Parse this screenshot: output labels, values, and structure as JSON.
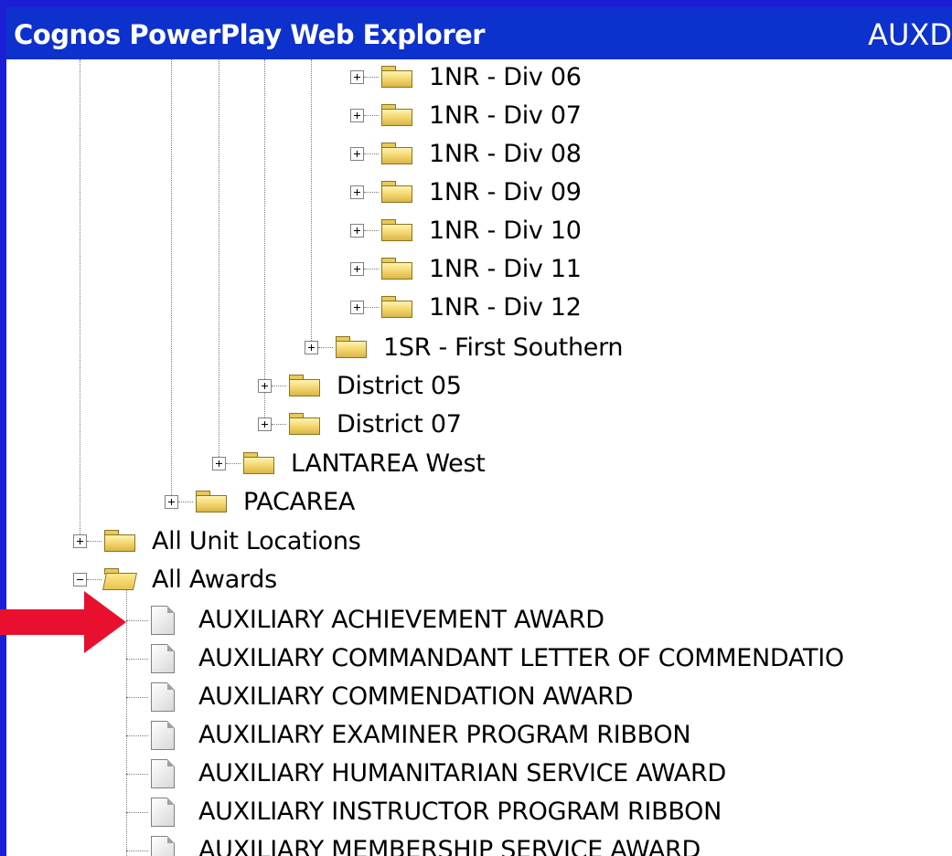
{
  "window": {
    "title": "Cognos PowerPlay Web Explorer",
    "title_right": "AUXD"
  },
  "tree": {
    "divisions": [
      {
        "label": "1NR - Div 06"
      },
      {
        "label": "1NR - Div 07"
      },
      {
        "label": "1NR - Div 08"
      },
      {
        "label": "1NR - Div 09"
      },
      {
        "label": "1NR - Div 10"
      },
      {
        "label": "1NR - Div 11"
      },
      {
        "label": "1NR - Div 12"
      }
    ],
    "first_southern": "1SR - First Southern",
    "districts": [
      {
        "label": "District 05"
      },
      {
        "label": "District 07"
      }
    ],
    "lantarea": "LANTAREA West",
    "pacarea": "PACAREA",
    "all_unit_locations": "All Unit Locations",
    "all_awards": "All Awards",
    "awards": [
      {
        "label": "AUXILIARY ACHIEVEMENT AWARD"
      },
      {
        "label": "AUXILIARY COMMANDANT LETTER OF COMMENDATIO"
      },
      {
        "label": "AUXILIARY COMMENDATION AWARD"
      },
      {
        "label": "AUXILIARY EXAMINER PROGRAM RIBBON"
      },
      {
        "label": "AUXILIARY HUMANITARIAN SERVICE AWARD"
      },
      {
        "label": "AUXILIARY INSTRUCTOR PROGRAM RIBBON"
      },
      {
        "label": "AUXILIARY MEMBERSHIP SERVICE AWARD"
      }
    ]
  },
  "colors": {
    "frame_blue": "#1a1fd6",
    "titlebar_blue": "#0d31cc",
    "arrow_red": "#e8102e"
  },
  "icons": {
    "expand": "plus-box-icon",
    "collapse": "minus-box-icon",
    "folder": "folder-icon",
    "open_folder": "open-folder-icon",
    "document": "document-icon",
    "pointer": "red-arrow-icon"
  }
}
